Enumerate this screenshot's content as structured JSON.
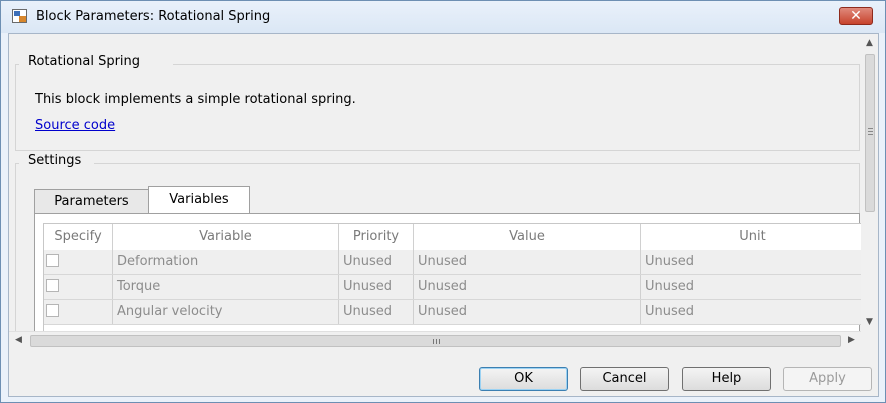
{
  "window": {
    "title": "Block Parameters: Rotational Spring",
    "close_glyph": "✕"
  },
  "block": {
    "group_title": "Rotational Spring",
    "description": "This block implements a simple rotational spring.",
    "source_link": "Source code"
  },
  "settings": {
    "group_title": "Settings",
    "tabs": [
      {
        "label": "Parameters",
        "selected": false
      },
      {
        "label": "Variables",
        "selected": true
      }
    ]
  },
  "variables_table": {
    "columns": [
      "Specify",
      "Variable",
      "Priority",
      "Value",
      "Unit"
    ],
    "rows": [
      {
        "specify": false,
        "variable": "Deformation",
        "priority": "Unused",
        "value": "Unused",
        "unit": "Unused"
      },
      {
        "specify": false,
        "variable": "Torque",
        "priority": "Unused",
        "value": "Unused",
        "unit": "Unused"
      },
      {
        "specify": false,
        "variable": "Angular velocity",
        "priority": "Unused",
        "value": "Unused",
        "unit": "Unused"
      }
    ]
  },
  "scrollbars": {
    "up": "▲",
    "down": "▼",
    "left": "◀",
    "right": "▶",
    "grip": "III"
  },
  "buttons": {
    "ok": "OK",
    "cancel": "Cancel",
    "help": "Help",
    "apply": "Apply"
  },
  "colors": {
    "link": "#0000cc",
    "close_button": "#c7432d",
    "default_button_border": "#3c7fb1"
  }
}
